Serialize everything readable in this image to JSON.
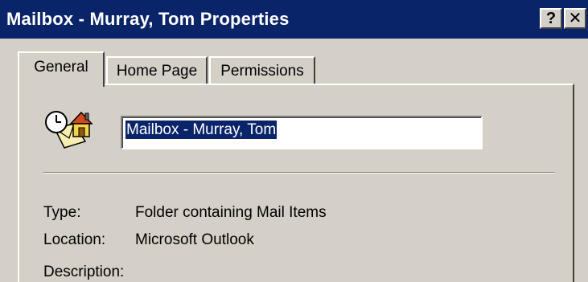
{
  "window": {
    "title": "Mailbox - Murray, Tom Properties",
    "help_label": "?",
    "close_label": "✕"
  },
  "tabs": [
    {
      "label": "General",
      "active": true
    },
    {
      "label": "Home Page",
      "active": false
    },
    {
      "label": "Permissions",
      "active": false
    }
  ],
  "general": {
    "icon": "folder-mailbox-icon",
    "name_value": "Mailbox - Murray, Tom",
    "type_label": "Type:",
    "type_value": "Folder containing Mail Items",
    "location_label": "Location:",
    "location_value": "Microsoft Outlook",
    "description_label": "Description:"
  },
  "colors": {
    "titlebar": "#0a246a",
    "face": "#d4d0c8",
    "selection": "#0a246a"
  }
}
